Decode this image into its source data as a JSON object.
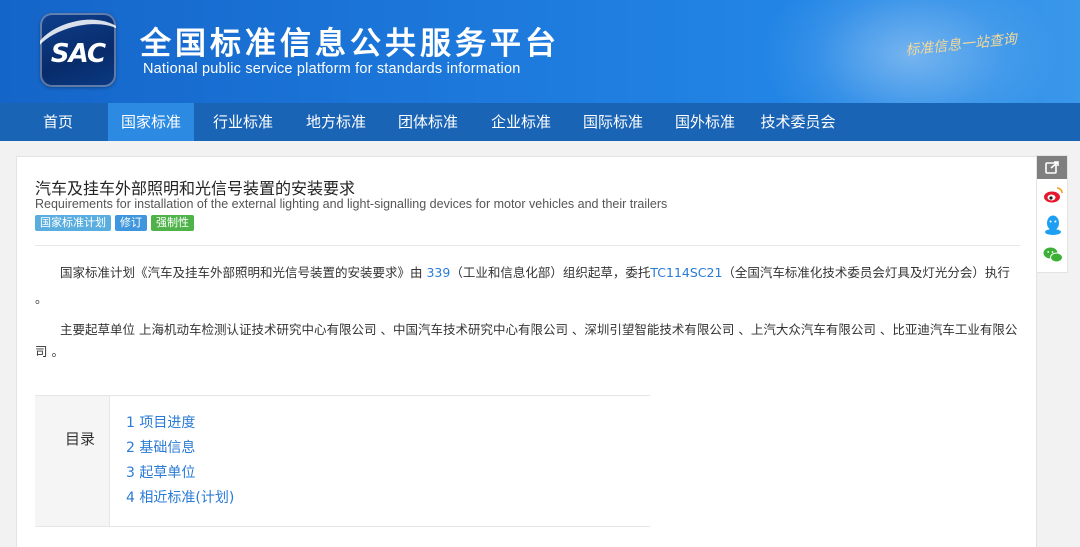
{
  "header": {
    "logo_text": "SAC",
    "title": "全国标准信息公共服务平台",
    "subtitle": "National public service platform  for standards information",
    "slogan": "标准信息一站查询"
  },
  "nav": {
    "items": [
      "首页",
      "国家标准",
      "行业标准",
      "地方标准",
      "团体标准",
      "企业标准",
      "国际标准",
      "国外标准",
      "技术委员会"
    ],
    "active_index": 1
  },
  "standard": {
    "title_cn": "汽车及挂车外部照明和光信号装置的安装要求",
    "title_en": "Requirements for installation of the external lighting and light-signalling devices for motor vehicles and their trailers",
    "badges": [
      {
        "label": "国家标准计划",
        "color": "#5aaedf"
      },
      {
        "label": "修订",
        "color": "#3f96de"
      },
      {
        "label": "强制性",
        "color": "#4fb34a"
      }
    ]
  },
  "para1": {
    "prefix": "国家标准计划《汽车及挂车外部照明和光信号装置的安装要求》由 ",
    "org_code": "339",
    "mid": "（工业和信息化部）组织起草，委托",
    "tc_code": "TC114SC21",
    "suffix": "（全国汽车标准化技术委员会灯具及灯光分会）执行",
    "end": "。"
  },
  "para2": {
    "line1": "主要起草单位 上海机动车检测认证技术研究中心有限公司 、中国汽车技术研究中心有限公司 、深圳引望智能技术有限公司 、上汽大众汽车有限公司 、比亚迪汽车工业有限公",
    "line2": "司 。"
  },
  "toc": {
    "label": "目录",
    "items": [
      "1  项目进度",
      "2  基础信息",
      "3  起草单位",
      "4  相近标准(计划)"
    ]
  },
  "share": {
    "icons": [
      "share-icon",
      "weibo-icon",
      "qq-icon",
      "wechat-icon"
    ]
  },
  "colors": {
    "nav_bg": "#1a64b6",
    "nav_active": "#2d8ae3",
    "link": "#2a7bd6"
  }
}
